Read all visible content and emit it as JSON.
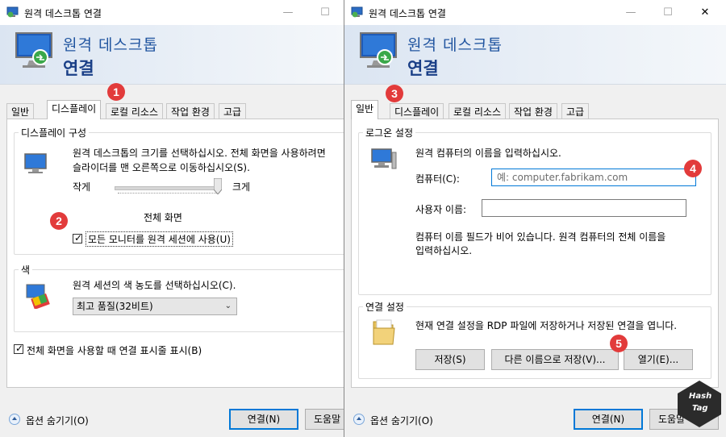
{
  "left_window": {
    "title": "원격 데스크톱 연결",
    "banner": {
      "line1": "원격 데스크톱",
      "line2": "연결"
    },
    "tabs": [
      {
        "label": "일반"
      },
      {
        "label": "디스플레이"
      },
      {
        "label": "로컬 리소스"
      },
      {
        "label": "작업 환경"
      },
      {
        "label": "고급"
      }
    ],
    "display_config": {
      "title": "디스플레이 구성",
      "description_line1": "원격 데스크톱의 크기를 선택하십시오. 전체 화면을 사용하려면",
      "description_line2": "슬라이더를 맨 오른쪽으로 이동하십시오(S).",
      "slider_small": "작게",
      "slider_large": "크게",
      "slider_value_label": "전체 화면",
      "slider_level": 1.0,
      "all_monitors_checkbox": {
        "label": "모든 모니터를 원격 세션에 사용(U)",
        "checked": true
      }
    },
    "colors": {
      "title": "색",
      "description": "원격 세션의 색 농도를 선택하십시오(C).",
      "selected": "최고 품질(32비트)"
    },
    "fullscreen_bar_checkbox": {
      "label": "전체 화면을 사용할 때 연결 표시줄 표시(B)",
      "checked": true
    },
    "bottom": {
      "options_label": "옵션 숨기기(O)",
      "connect_label": "연결(N)",
      "help_label": "도움말"
    }
  },
  "right_window": {
    "title": "원격 데스크톱 연결",
    "banner": {
      "line1": "원격 데스크톱",
      "line2": "연결"
    },
    "tabs": [
      {
        "label": "일반"
      },
      {
        "label": "디스플레이"
      },
      {
        "label": "로컬 리소스"
      },
      {
        "label": "작업 환경"
      },
      {
        "label": "고급"
      }
    ],
    "logon": {
      "title": "로그온 설정",
      "description": "원격 컴퓨터의 이름을 입력하십시오.",
      "computer_label": "컴퓨터(C):",
      "computer_placeholder": "예: computer.fabrikam.com",
      "username_label": "사용자 이름:",
      "username_value": "",
      "hint_line1": "컴퓨터 이름 필드가 비어 있습니다. 원격 컴퓨터의 전체 이름을",
      "hint_line2": "입력하십시오."
    },
    "connection": {
      "title": "연결 설정",
      "description": "현재 연결 설정을 RDP 파일에 저장하거나 저장된 연결을 엽니다.",
      "save_label": "저장(S)",
      "save_as_label": "다른 이름으로 저장(V)...",
      "open_label": "열기(E)..."
    },
    "bottom": {
      "options_label": "옵션 숨기기(O)",
      "connect_label": "연결(N)",
      "help_label": "도움말"
    }
  },
  "annotations": [
    "1",
    "2",
    "3",
    "4",
    "5"
  ],
  "watermark": {
    "line1": "Hash",
    "line2": "Tag"
  },
  "accent_colors": {
    "focus": "#0078d7",
    "badge": "#e23b3b",
    "banner_text": "#2155a0"
  }
}
